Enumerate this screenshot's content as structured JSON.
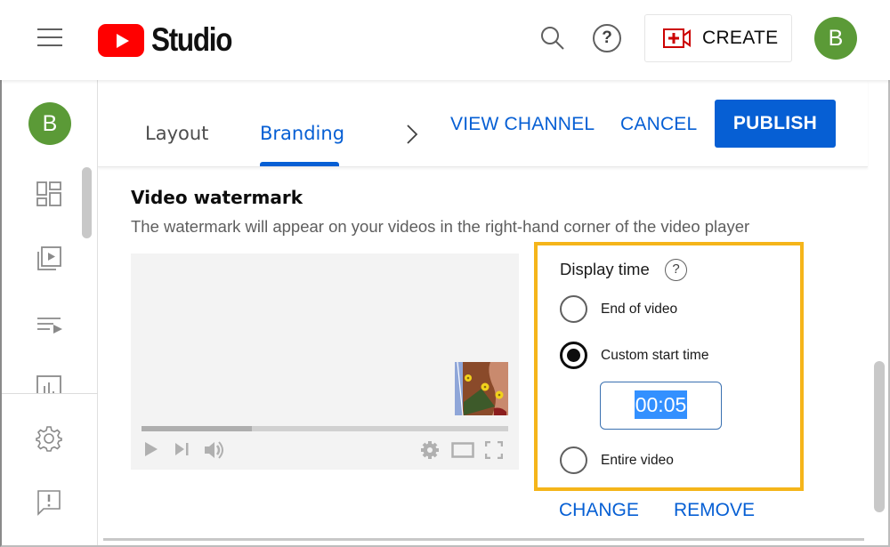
{
  "app": {
    "title": "Studio",
    "brand_color": "#ff0000",
    "accent_color": "#065fd4",
    "highlight_color": "#f5b51a"
  },
  "topbar": {
    "menu_icon": "hamburger-menu-icon",
    "search_icon": "search-icon",
    "help_icon": "help-icon",
    "help_glyph": "?",
    "create_label": "CREATE",
    "create_icon": "video-camera-plus-icon",
    "avatar_letter": "B",
    "avatar_color": "#5b9a37"
  },
  "sidebar": {
    "avatar_letter": "B",
    "items": [
      {
        "name": "dashboard",
        "icon": "dashboard-icon"
      },
      {
        "name": "content",
        "icon": "video-library-icon"
      },
      {
        "name": "playlists",
        "icon": "playlist-icon"
      },
      {
        "name": "analytics",
        "icon": "analytics-icon"
      }
    ],
    "bottom_items": [
      {
        "name": "settings",
        "icon": "gear-icon"
      },
      {
        "name": "feedback",
        "icon": "feedback-icon"
      }
    ]
  },
  "tabs": {
    "items": [
      {
        "label": "Layout",
        "active": false
      },
      {
        "label": "Branding",
        "active": true
      }
    ],
    "next_icon": "chevron-right-icon"
  },
  "actions": {
    "view_channel": "VIEW CHANNEL",
    "cancel": "CANCEL",
    "publish": "PUBLISH"
  },
  "watermark_section": {
    "title": "Video watermark",
    "description": "The watermark will appear on your videos in the right-hand corner of the video player",
    "player": {
      "progress_fraction": 0.3,
      "controls": [
        "play-icon",
        "next-icon",
        "volume-icon",
        "settings-icon",
        "theater-mode-icon",
        "fullscreen-icon"
      ]
    },
    "display_time": {
      "title": "Display time",
      "help_glyph": "?",
      "options": [
        {
          "label": "End of video",
          "checked": false
        },
        {
          "label": "Custom start time",
          "checked": true
        },
        {
          "label": "Entire video",
          "checked": false
        }
      ],
      "custom_start_time": "00:05"
    },
    "change_label": "CHANGE",
    "remove_label": "REMOVE"
  }
}
